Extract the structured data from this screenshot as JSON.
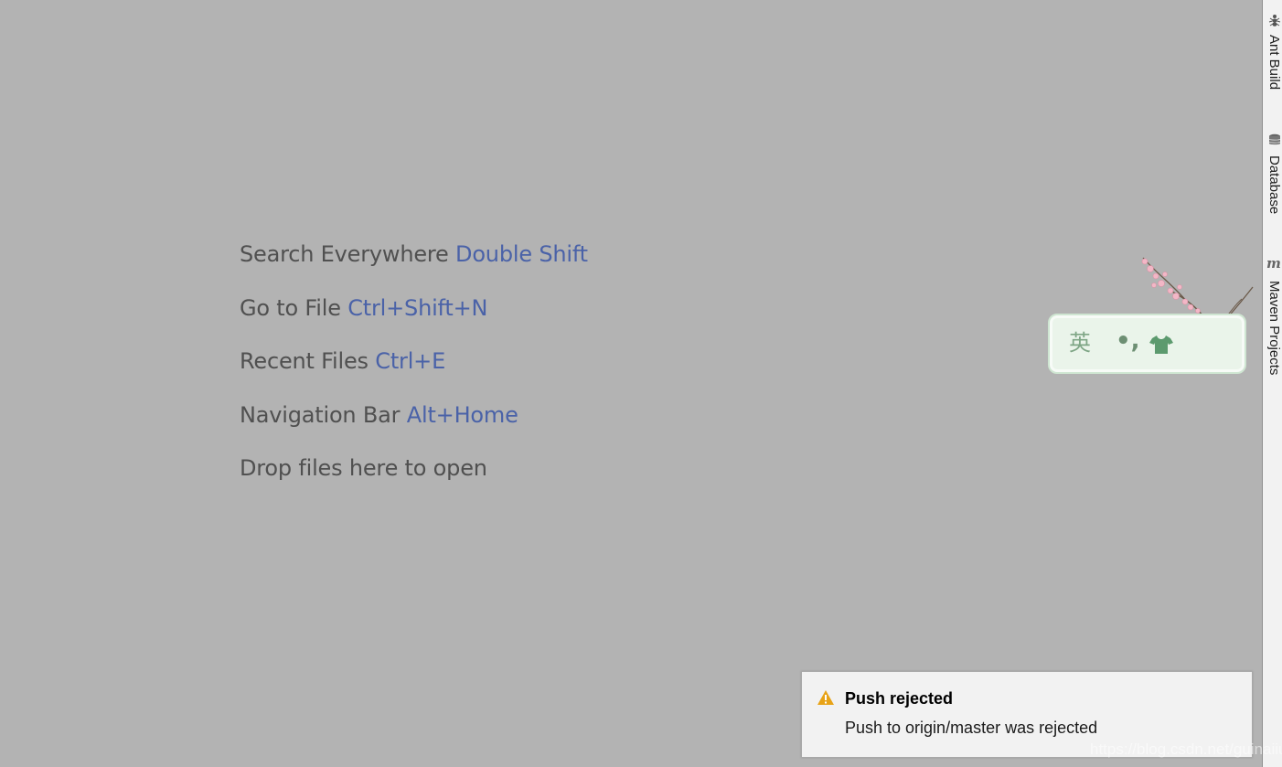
{
  "welcome_hints": [
    {
      "label": "Search Everywhere",
      "shortcut": "Double Shift"
    },
    {
      "label": "Go to File",
      "shortcut": "Ctrl+Shift+N"
    },
    {
      "label": "Recent Files",
      "shortcut": "Ctrl+E"
    },
    {
      "label": "Navigation Bar",
      "shortcut": "Alt+Home"
    },
    {
      "label": "Drop files here to open",
      "shortcut": ""
    }
  ],
  "tool_windows": [
    {
      "label": "Ant Build",
      "icon": "ant-icon"
    },
    {
      "label": "Database",
      "icon": "database-icon"
    },
    {
      "label": "Maven Projects",
      "icon": "maven-icon"
    }
  ],
  "ime": {
    "mode": "英",
    "punctuation": "•,",
    "skin_icon": "shirt-icon"
  },
  "notification": {
    "icon": "warning-icon",
    "title": "Push rejected",
    "message": "Push to origin/master was rejected"
  },
  "watermark": "https://blog.csdn.net/guinaiiu",
  "colors": {
    "editor_bg": "#b3b3b3",
    "hint_text": "#505050",
    "shortcut_text": "#4a62a8",
    "warning": "#e8a317"
  }
}
